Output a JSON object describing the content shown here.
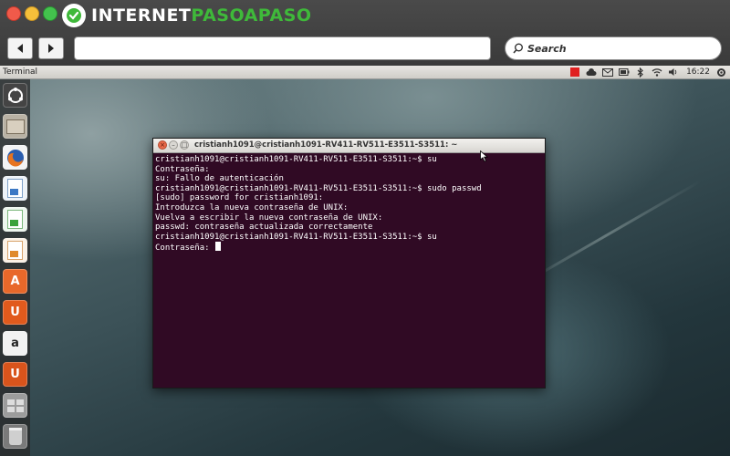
{
  "browser": {
    "brand_part1": "INTERNET",
    "brand_part2": "PASOAPASO",
    "back_icon": "arrow-left-icon",
    "forward_icon": "arrow-right-icon",
    "url_value": "",
    "search_label": "Search"
  },
  "panel": {
    "app_title": "Terminal",
    "time": "16:22",
    "tray_icons": [
      "red-status-icon",
      "cloud-icon",
      "mail-icon",
      "battery-icon",
      "bluetooth-icon",
      "wifi-icon",
      "volume-icon",
      "settings-icon"
    ]
  },
  "launcher": {
    "icons": [
      "dash-icon",
      "files-icon",
      "firefox-icon",
      "writer-icon",
      "calc-icon",
      "impress-icon",
      "software-center-icon",
      "ubuntu-one-icon",
      "amazon-icon",
      "ubuntu-one-music-icon",
      "workspaces-icon",
      "trash-icon"
    ]
  },
  "terminal": {
    "title": "cristianh1091@cristianh1091-RV411-RV511-E3511-S3511: ~",
    "lines": [
      "cristianh1091@cristianh1091-RV411-RV511-E3511-S3511:~$ su",
      "Contraseña:",
      "su: Fallo de autenticación",
      "cristianh1091@cristianh1091-RV411-RV511-E3511-S3511:~$ sudo passwd",
      "[sudo] password for cristianh1091:",
      "Introduzca la nueva contraseña de UNIX:",
      "Vuelva a escribir la nueva contraseña de UNIX:",
      "passwd: contraseña actualizada correctamente",
      "cristianh1091@cristianh1091-RV411-RV511-E3511-S3511:~$ su"
    ],
    "prompt_line": "Contraseña: "
  },
  "colors": {
    "terminal_bg": "#300a24",
    "brand_green": "#3fb93a"
  }
}
